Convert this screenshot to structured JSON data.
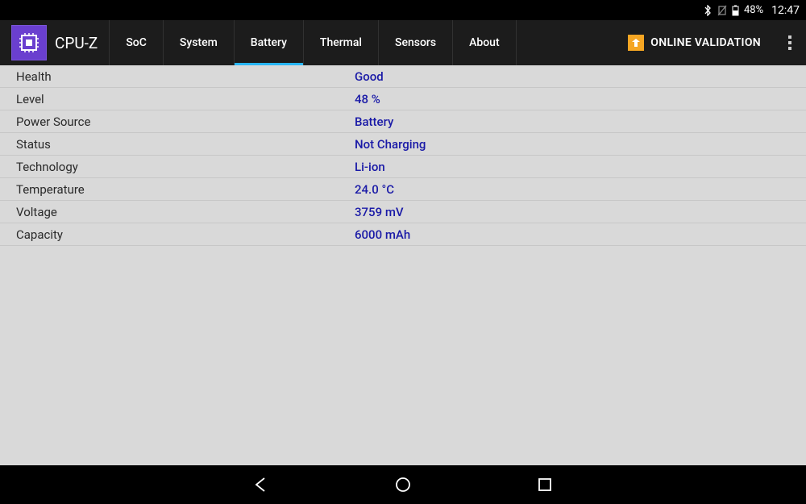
{
  "status": {
    "battery": "48%",
    "time": "12:47"
  },
  "app": {
    "title": "CPU-Z",
    "validation_label": "ONLINE VALIDATION"
  },
  "tabs": [
    {
      "label": "SoC"
    },
    {
      "label": "System"
    },
    {
      "label": "Battery",
      "active": true
    },
    {
      "label": "Thermal"
    },
    {
      "label": "Sensors"
    },
    {
      "label": "About"
    }
  ],
  "battery": {
    "rows": [
      {
        "label": "Health",
        "value": "Good"
      },
      {
        "label": "Level",
        "value": "48 %"
      },
      {
        "label": "Power Source",
        "value": "Battery"
      },
      {
        "label": "Status",
        "value": "Not Charging"
      },
      {
        "label": "Technology",
        "value": "Li-ion"
      },
      {
        "label": "Temperature",
        "value": "24.0 °C"
      },
      {
        "label": "Voltage",
        "value": "3759 mV"
      },
      {
        "label": "Capacity",
        "value": "6000 mAh"
      }
    ]
  }
}
